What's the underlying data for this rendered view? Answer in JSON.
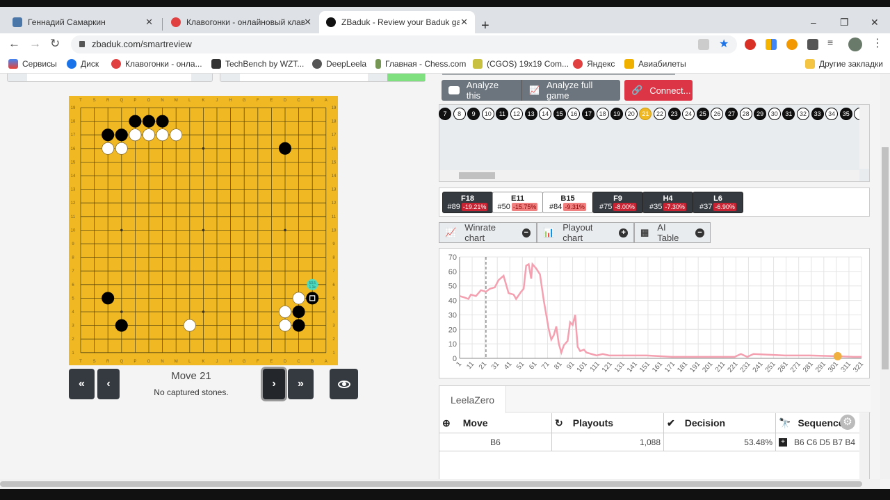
{
  "browser": {
    "tabs": [
      {
        "title": "Геннадий Самаркин",
        "favicon": "vk-icon",
        "color": "#4a76a8"
      },
      {
        "title": "Клавогонки - онлайновый клав",
        "favicon": "car-icon",
        "color": "#e04040"
      },
      {
        "title": "ZBaduk - Review your Baduk gam",
        "favicon": "zbaduk-icon",
        "color": "#111111",
        "active": true
      }
    ],
    "new_tab": "+",
    "url": "zbaduk.com/smartreview",
    "window_controls": [
      "–",
      "❐",
      "✕"
    ],
    "bookmarks": [
      {
        "label": "Сервисы",
        "icon": "apps-grid-icon"
      },
      {
        "label": "Диск",
        "icon": "disk-icon"
      },
      {
        "label": "Клавогонки - онла...",
        "icon": "car-icon"
      },
      {
        "label": "TechBench by WZT...",
        "icon": "windows-icon"
      },
      {
        "label": "DeepLeela",
        "icon": "globe-icon"
      },
      {
        "label": "Главная - Chess.com",
        "icon": "pawn-icon"
      },
      {
        "label": "(CGOS) 19x19 Com...",
        "icon": "robot-icon"
      },
      {
        "label": "Яндекс",
        "icon": "yandex-icon"
      },
      {
        "label": "Авиабилеты",
        "icon": "plane-icon"
      }
    ],
    "other_bookmarks": "Другие закладки"
  },
  "board": {
    "columns": [
      "T",
      "S",
      "R",
      "Q",
      "P",
      "O",
      "N",
      "M",
      "L",
      "K",
      "J",
      "H",
      "G",
      "F",
      "E",
      "D",
      "C",
      "B",
      "A"
    ],
    "rows": [
      "19",
      "18",
      "17",
      "16",
      "15",
      "14",
      "13",
      "12",
      "11",
      "10",
      "9",
      "8",
      "7",
      "6",
      "5",
      "4",
      "3",
      "2",
      "1"
    ],
    "stones": [
      {
        "c": "black",
        "pos": "P18"
      },
      {
        "c": "black",
        "pos": "O18"
      },
      {
        "c": "black",
        "pos": "N18"
      },
      {
        "c": "black",
        "pos": "R17"
      },
      {
        "c": "black",
        "pos": "Q17"
      },
      {
        "c": "white",
        "pos": "P17"
      },
      {
        "c": "white",
        "pos": "O17"
      },
      {
        "c": "white",
        "pos": "N17"
      },
      {
        "c": "white",
        "pos": "M17"
      },
      {
        "c": "white",
        "pos": "R16"
      },
      {
        "c": "white",
        "pos": "Q16"
      },
      {
        "c": "black",
        "pos": "D16"
      },
      {
        "c": "black",
        "pos": "R5"
      },
      {
        "c": "black",
        "pos": "Q3"
      },
      {
        "c": "white",
        "pos": "L3"
      },
      {
        "c": "white",
        "pos": "C5"
      },
      {
        "c": "black",
        "pos": "B5",
        "last": true
      },
      {
        "c": "white",
        "pos": "D4"
      },
      {
        "c": "black",
        "pos": "C4"
      },
      {
        "c": "white",
        "pos": "D3"
      },
      {
        "c": "black",
        "pos": "C3"
      }
    ],
    "hint": {
      "pos": "B6",
      "line1": "53.5",
      "line2": "1.1k",
      "color": "#40e0d0"
    }
  },
  "navigation": {
    "first": "«",
    "prev": "‹",
    "next": "›",
    "last": "»",
    "move_label": "Move 21",
    "captured": "No captured stones."
  },
  "actions": {
    "analyze_this": "Analyze this",
    "analyze_full": "Analyze full game",
    "connect": "Connect...",
    "connect_color": "#dc3545"
  },
  "move_strip": {
    "start": 7,
    "end": 35,
    "current": 21
  },
  "mistakes": [
    {
      "coord": "F18",
      "move": "#89",
      "pct": "-19.21%",
      "style": "dark"
    },
    {
      "coord": "E11",
      "move": "#50",
      "pct": "-15.75%",
      "style": "light"
    },
    {
      "coord": "B15",
      "move": "#84",
      "pct": "-9.31%",
      "style": "light"
    },
    {
      "coord": "F9",
      "move": "#75",
      "pct": "-8.00%",
      "style": "dark"
    },
    {
      "coord": "H4",
      "move": "#35",
      "pct": "-7.30%",
      "style": "dark"
    },
    {
      "coord": "L6",
      "move": "#37",
      "pct": "-6.90%",
      "style": "dark"
    }
  ],
  "toggles": [
    {
      "label": "Winrate chart",
      "icon": "line-chart-icon",
      "state": "−"
    },
    {
      "label": "Playout chart",
      "icon": "bar-chart-icon",
      "state": "+"
    },
    {
      "label": "AI Table",
      "icon": "grid-icon",
      "state": "−"
    }
  ],
  "chart_data": {
    "type": "line",
    "title": "",
    "xlabel": "",
    "ylabel": "",
    "ylim": [
      0,
      70
    ],
    "yticks": [
      0,
      10,
      20,
      30,
      40,
      50,
      60,
      70
    ],
    "xticks": [
      1,
      11,
      21,
      31,
      41,
      51,
      61,
      71,
      81,
      91,
      101,
      111,
      121,
      131,
      141,
      151,
      161,
      171,
      181,
      191,
      201,
      211,
      221,
      231,
      241,
      251,
      261,
      271,
      281,
      291,
      301,
      311,
      321
    ],
    "grid": true,
    "current_move_marker": 22,
    "highlight_point": {
      "x": 302,
      "y": 1.5,
      "color": "#f0b040"
    },
    "line_color": "#f4a0b0",
    "series": [
      {
        "name": "winrate",
        "points": [
          [
            1,
            43
          ],
          [
            5,
            42
          ],
          [
            8,
            41
          ],
          [
            10,
            44
          ],
          [
            14,
            43
          ],
          [
            18,
            47
          ],
          [
            22,
            46
          ],
          [
            25,
            48
          ],
          [
            29,
            49
          ],
          [
            32,
            54
          ],
          [
            36,
            57
          ],
          [
            40,
            45
          ],
          [
            44,
            44
          ],
          [
            46,
            41
          ],
          [
            50,
            46
          ],
          [
            52,
            48
          ],
          [
            54,
            64
          ],
          [
            56,
            65
          ],
          [
            58,
            55
          ],
          [
            59,
            65
          ],
          [
            62,
            62
          ],
          [
            65,
            58
          ],
          [
            68,
            40
          ],
          [
            72,
            20
          ],
          [
            74,
            13
          ],
          [
            76,
            16
          ],
          [
            78,
            22
          ],
          [
            80,
            10
          ],
          [
            82,
            4
          ],
          [
            84,
            9
          ],
          [
            87,
            12
          ],
          [
            89,
            25
          ],
          [
            91,
            23
          ],
          [
            93,
            30
          ],
          [
            95,
            8
          ],
          [
            97,
            5
          ],
          [
            100,
            6
          ],
          [
            102,
            4
          ],
          [
            106,
            3
          ],
          [
            110,
            2
          ],
          [
            115,
            3
          ],
          [
            120,
            2
          ],
          [
            150,
            2
          ],
          [
            170,
            1
          ],
          [
            220,
            1
          ],
          [
            225,
            3
          ],
          [
            230,
            1
          ],
          [
            235,
            3
          ],
          [
            260,
            2
          ],
          [
            280,
            2
          ],
          [
            300,
            1.5
          ],
          [
            315,
            1
          ],
          [
            321,
            1
          ]
        ]
      }
    ]
  },
  "ai_table": {
    "engine_tab": "LeelaZero",
    "columns": [
      {
        "label": "Move",
        "icon": "crosshair-icon"
      },
      {
        "label": "Playouts",
        "icon": "refresh-icon"
      },
      {
        "label": "Decision",
        "icon": "check-double-icon"
      },
      {
        "label": "Sequence",
        "icon": "binoculars-icon"
      }
    ],
    "rows": [
      {
        "move": "B6",
        "playouts": "1,088",
        "decision": "53.48%",
        "sequence": "B6 C6 D5 B7 B4"
      }
    ]
  }
}
